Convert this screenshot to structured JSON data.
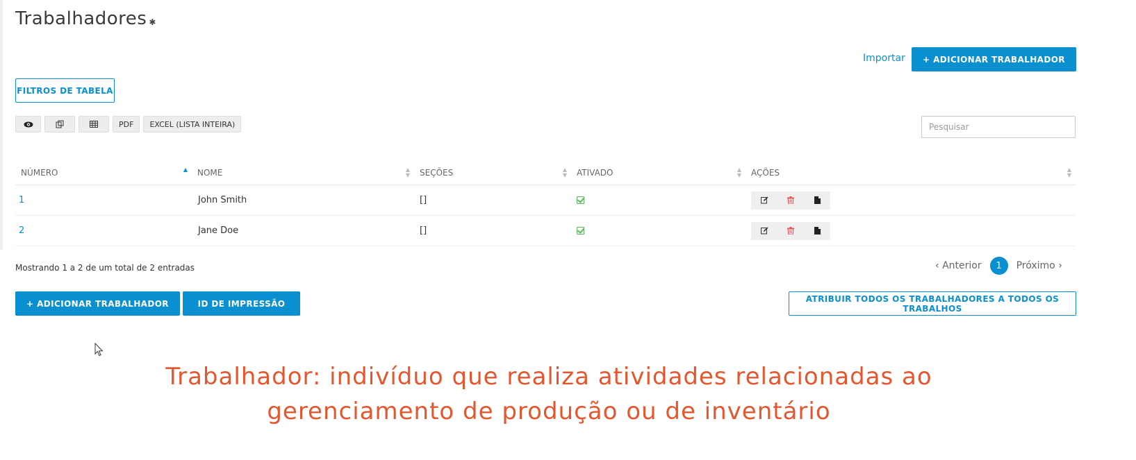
{
  "page": {
    "title": "Trabalhadores",
    "settings_icon": "gear-icon"
  },
  "header_actions": {
    "import_label": "Importar",
    "add_worker_label": "+ ADICIONAR TRABALHADOR"
  },
  "filters": {
    "label": "FILTROS DE TABELA"
  },
  "toolbar": {
    "view_icon": "eye-icon",
    "copy_icon": "copy-icon",
    "columns_icon": "table-icon",
    "pdf_label": "PDF",
    "excel_label": "EXCEL (LISTA INTEIRA)"
  },
  "search": {
    "placeholder": "Pesquisar"
  },
  "table": {
    "columns": [
      "NÚMERO",
      "NOME",
      "SEÇÕES",
      "ATIVADO",
      "AÇÕES"
    ],
    "rows": [
      {
        "number": "1",
        "name": "John Smith",
        "sections": "[]",
        "enabled": true
      },
      {
        "number": "2",
        "name": "Jane Doe",
        "sections": "[]",
        "enabled": true
      }
    ]
  },
  "footer": {
    "info": "Mostrando 1 a 2 de um total de 2 entradas",
    "prev_label": "Anterior",
    "page": "1",
    "next_label": "Próximo",
    "add_worker_label": "+ ADICIONAR TRABALHADOR",
    "print_id_label": "ID DE IMPRESSÃO",
    "assign_all_label": "ATRIBUIR TODOS OS TRABALHADORES A TODOS OS TRABALHOS"
  },
  "caption": {
    "line1": "Trabalhador: indivíduo que realiza atividades relacionadas ao",
    "line2": "gerenciamento de produção ou de inventário"
  },
  "colors": {
    "accent": "#0a8fd1",
    "enabled_check": "#5cb85c",
    "delete_icon": "#e05555",
    "caption": "#e4572e"
  }
}
